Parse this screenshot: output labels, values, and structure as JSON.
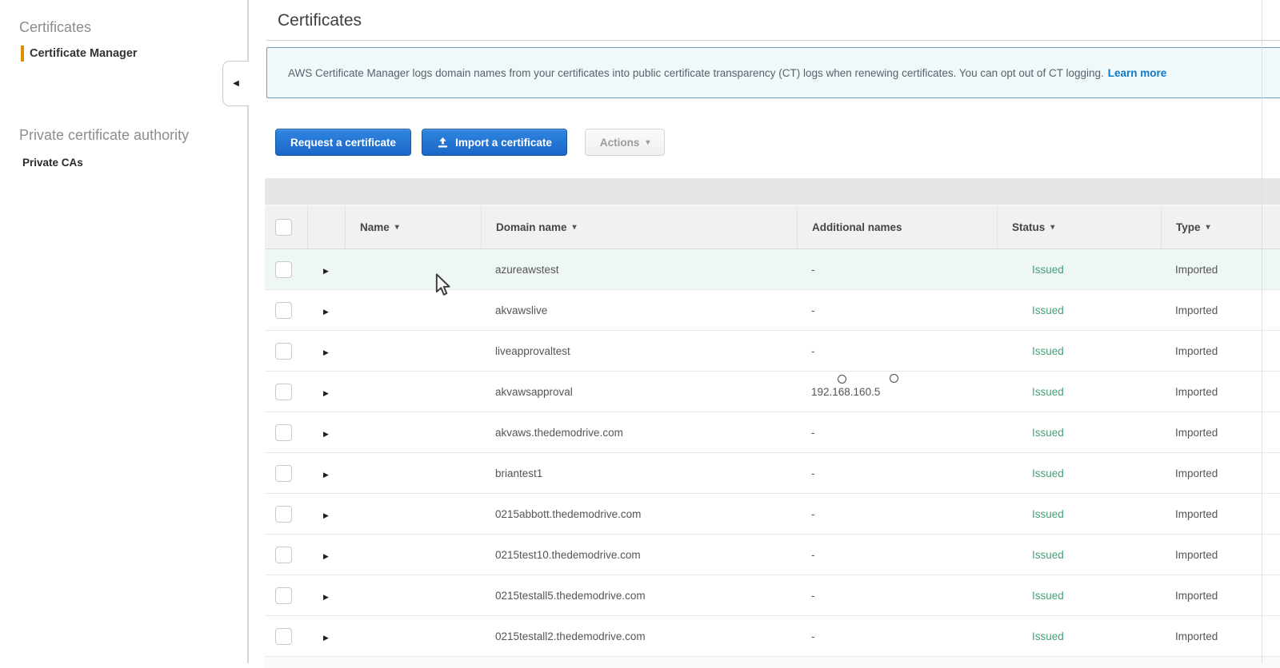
{
  "sidebar": {
    "section1_title": "Certificates",
    "certificate_manager_label": "Certificate Manager",
    "section2_title": "Private certificate authority",
    "private_cas_label": "Private CAs"
  },
  "header": {
    "title": "Certificates"
  },
  "banner": {
    "text": "AWS Certificate Manager logs domain names from your certificates into public certificate transparency (CT) logs when renewing certificates. You can opt out of CT logging.",
    "link_label": "Learn more"
  },
  "toolbar": {
    "request_label": "Request a certificate",
    "import_label": "Import a certificate",
    "actions_label": "Actions"
  },
  "icons": {
    "sort_caret": "▾",
    "dropdown_caret": "▾",
    "expand_arrow": "▶",
    "collapse_arrow": "◀",
    "import_icon": "upload-icon"
  },
  "table": {
    "columns": [
      {
        "key": "check",
        "label": "",
        "sortable": false
      },
      {
        "key": "arrow",
        "label": "",
        "sortable": false
      },
      {
        "key": "name",
        "label": "Name",
        "sortable": true
      },
      {
        "key": "domain",
        "label": "Domain name",
        "sortable": true
      },
      {
        "key": "add",
        "label": "Additional names",
        "sortable": false
      },
      {
        "key": "status",
        "label": "Status",
        "sortable": true
      },
      {
        "key": "type",
        "label": "Type",
        "sortable": true
      }
    ],
    "rows": [
      {
        "name": "",
        "domain": "azureawstest",
        "additional": "-",
        "status": "Issued",
        "type": "Imported",
        "highlight": true
      },
      {
        "name": "",
        "domain": "akvawslive",
        "additional": "-",
        "status": "Issued",
        "type": "Imported"
      },
      {
        "name": "",
        "domain": "liveapprovaltest",
        "additional": "-",
        "status": "Issued",
        "type": "Imported"
      },
      {
        "name": "",
        "domain": "akvawsapproval",
        "additional": "192.168.160.5",
        "status": "Issued",
        "type": "Imported"
      },
      {
        "name": "",
        "domain": "akvaws.thedemodrive.com",
        "additional": "-",
        "status": "Issued",
        "type": "Imported"
      },
      {
        "name": "",
        "domain": "briantest1",
        "additional": "-",
        "status": "Issued",
        "type": "Imported"
      },
      {
        "name": "",
        "domain": "0215abbott.thedemodrive.com",
        "additional": "-",
        "status": "Issued",
        "type": "Imported"
      },
      {
        "name": "",
        "domain": "0215test10.thedemodrive.com",
        "additional": "-",
        "status": "Issued",
        "type": "Imported"
      },
      {
        "name": "",
        "domain": "0215testall5.thedemodrive.com",
        "additional": "-",
        "status": "Issued",
        "type": "Imported"
      },
      {
        "name": "",
        "domain": "0215testall2.thedemodrive.com",
        "additional": "-",
        "status": "Issued",
        "type": "Imported"
      }
    ]
  },
  "colors": {
    "primary_button": "#1b66c6",
    "active_nav_accent": "#dd8e00",
    "status_issued": "#44a173",
    "banner_border": "#6f9fc0",
    "banner_bg": "#f1f8fa",
    "link": "#0b7ac9"
  }
}
